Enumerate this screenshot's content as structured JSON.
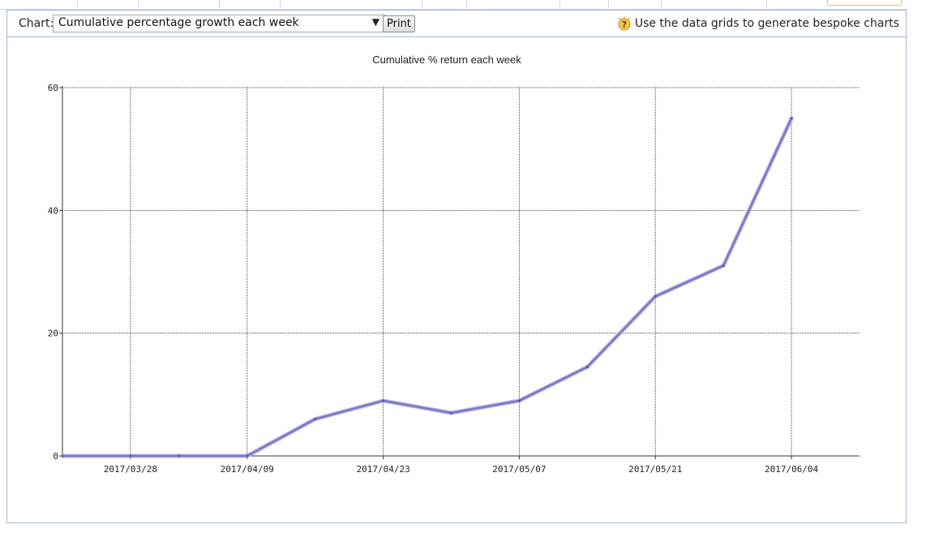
{
  "toolbar": {
    "chart_label": "Chart:",
    "selected_chart": "Cumulative percentage growth each week",
    "print_label": "Print",
    "hint_text": "Use the data grids to generate bespoke charts"
  },
  "colors": {
    "line": "#7b78c9",
    "frame": "#9fb8d8",
    "grid": "#444444"
  },
  "chart_data": {
    "type": "line",
    "title": "Cumulative % return each week",
    "xlabel": "",
    "ylabel": "",
    "ylim": [
      0,
      60
    ],
    "yticks": [
      0,
      20,
      40,
      60
    ],
    "xlim": [
      "2017/03/21",
      "2017/06/11"
    ],
    "xticks": [
      "2017/03/28",
      "2017/04/09",
      "2017/04/23",
      "2017/05/07",
      "2017/05/21",
      "2017/06/04"
    ],
    "grid": true,
    "x": [
      "2017/03/21",
      "2017/03/28",
      "2017/04/02",
      "2017/04/09",
      "2017/04/16",
      "2017/04/23",
      "2017/04/30",
      "2017/05/07",
      "2017/05/14",
      "2017/05/21",
      "2017/05/28",
      "2017/06/04"
    ],
    "series": [
      {
        "values": [
          0,
          0,
          0,
          0,
          6,
          9,
          7,
          9,
          14.5,
          26,
          31,
          55
        ]
      }
    ]
  }
}
